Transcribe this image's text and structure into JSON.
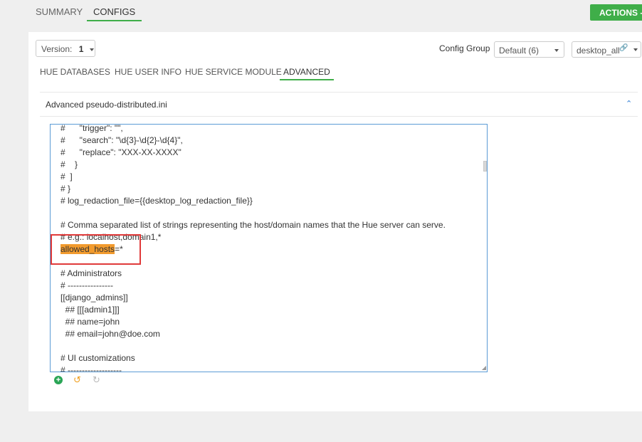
{
  "top_tabs": {
    "summary": "SUMMARY",
    "configs": "CONFIGS"
  },
  "actions_label": "ACTIONS -",
  "version": {
    "label": "Version:",
    "value": "1"
  },
  "config_group": {
    "label": "Config Group",
    "selected": "Default (6)"
  },
  "host_select": {
    "value": "desktop_all"
  },
  "sub_tabs": [
    "HUE DATABASES",
    "HUE USER INFO",
    "HUE SERVICE MODULE",
    "ADVANCED"
  ],
  "section_title": "Advanced pseudo-distributed.ini",
  "code_lines": [
    "#      \"trigger\": \"\",",
    "#      \"search\": \"\\d{3}-\\d{2}-\\d{4}\",",
    "#      \"replace\": \"XXX-XX-XXXX\"",
    "#    }",
    "#  ]",
    "# }",
    "# log_redaction_file={{desktop_log_redaction_file}}",
    "",
    "# Comma separated list of strings representing the host/domain names that the Hue server can serve.",
    "# e.g.: localhost,domain1,*",
    "",
    "",
    "# Administrators",
    "# ----------------",
    "[[django_admins]]",
    "  ## [[[admin1]]]",
    "  ## name=john",
    "  ## email=john@doe.com",
    "",
    "# UI customizations",
    "# -------------------"
  ],
  "highlight_line": {
    "key": "allowed_hosts",
    "rest": "=*"
  },
  "colors": {
    "accent": "#3fae49",
    "highlight": "#f29b2e",
    "annotation": "#e03a3a"
  }
}
